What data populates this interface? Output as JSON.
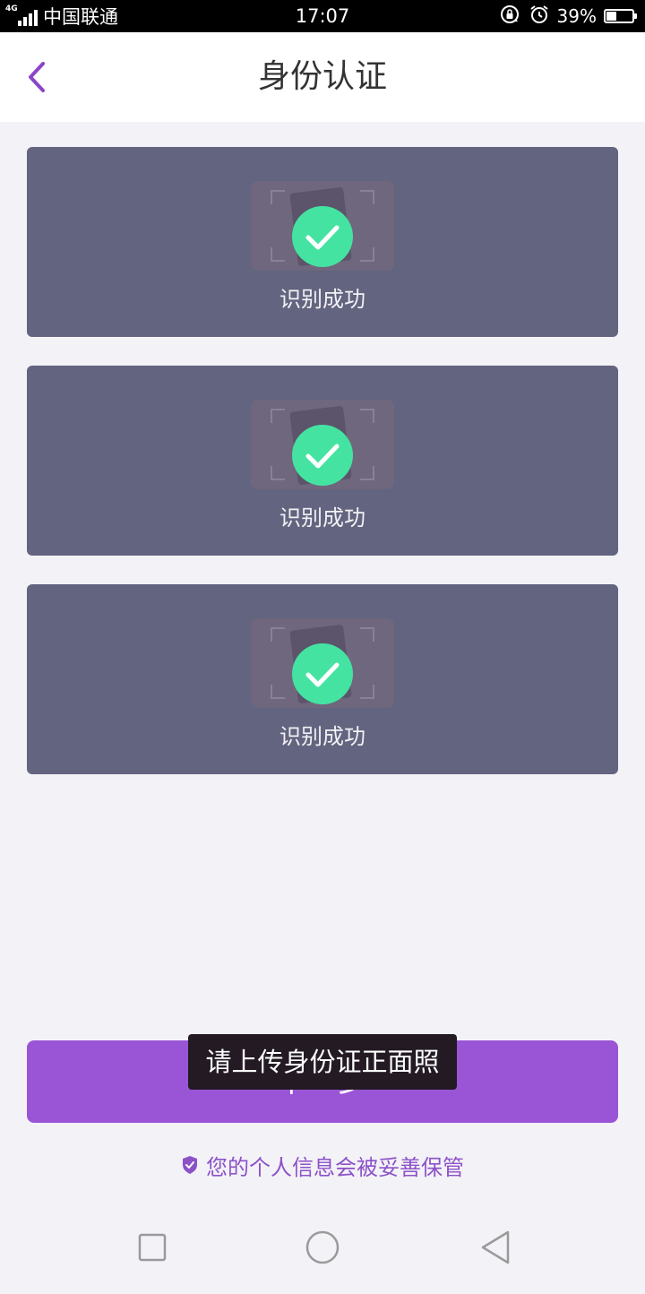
{
  "status_bar": {
    "network": "4G",
    "carrier": "中国联通",
    "time": "17:07",
    "battery": "39%",
    "battery_level": 0.39,
    "icons": [
      "signal-icon",
      "rotation-lock-icon",
      "alarm-icon",
      "battery-icon"
    ]
  },
  "header": {
    "title": "身份认证",
    "back_icon": "chevron-left-icon"
  },
  "cards": [
    {
      "status": "识别成功",
      "icon": "check-circle-icon"
    },
    {
      "status": "识别成功",
      "icon": "check-circle-icon"
    },
    {
      "status": "识别成功",
      "icon": "check-circle-icon"
    }
  ],
  "next_button": {
    "label": "下一步"
  },
  "toast": {
    "message": "请上传身份证正面照"
  },
  "privacy": {
    "text": "您的个人信息会被妥善保管",
    "icon": "shield-check-icon"
  },
  "nav_bar": {
    "icons": [
      "recent-apps-icon",
      "home-icon",
      "back-icon"
    ]
  },
  "colors": {
    "accent": "#9a55d7",
    "card": "#63647f",
    "success": "#45e3a2",
    "background": "#f3f2f7"
  }
}
